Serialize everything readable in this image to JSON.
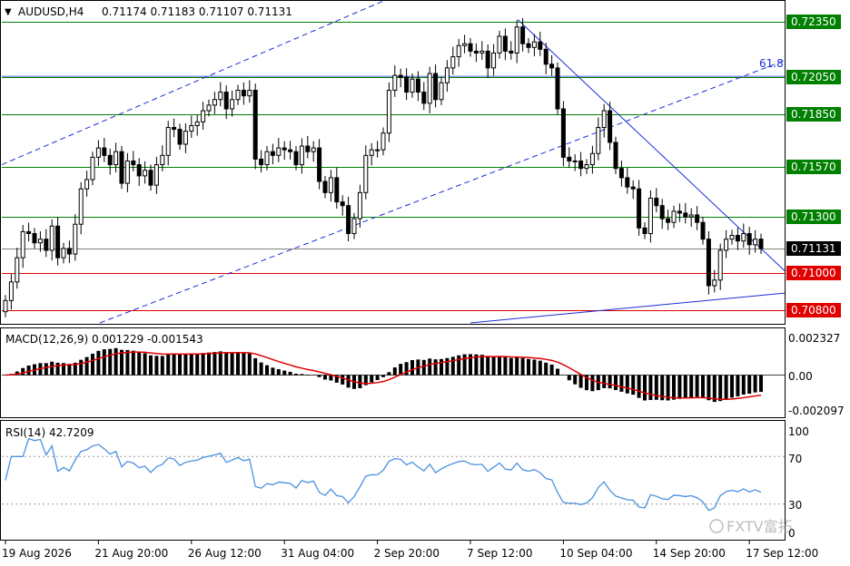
{
  "header": {
    "symbol_label": "AUDUSD,H4",
    "ohlc_label": "0.71174 0.71183 0.71107 0.71131"
  },
  "indicators": {
    "fib_label": "61.8",
    "macd_label": "MACD(12,26,9) 0.001229 -0.001543",
    "macd_scale": [
      "0.002327",
      "0.00",
      "-0.002097"
    ],
    "rsi_label": "RSI(14) 42.7209",
    "rsi_scale": [
      "100",
      "70",
      "30",
      "0"
    ]
  },
  "watermark": "FXTV富拓",
  "colors": {
    "support_line": "#e00000",
    "level_line": "#008000",
    "channel": "#1a2fd6",
    "rsi": "#4a90e2",
    "macd_signal": "#e00000",
    "current_price_badge": "#000000"
  },
  "chart_data": {
    "type": "candlestick",
    "symbol": "AUDUSD",
    "timeframe": "H4",
    "ylim": [
      0.70725,
      0.7246
    ],
    "current_price": "0.71131",
    "price_labels": [
      {
        "text": "0.72350",
        "price": 0.7235,
        "kind": "level"
      },
      {
        "text": "0.72050",
        "price": 0.7205,
        "kind": "level"
      },
      {
        "text": "0.71850",
        "price": 0.7185,
        "kind": "level"
      },
      {
        "text": "0.71570",
        "price": 0.7157,
        "kind": "level"
      },
      {
        "text": "0.71300",
        "price": 0.713,
        "kind": "level"
      },
      {
        "text": "0.71131",
        "price": 0.71131,
        "kind": "current"
      },
      {
        "text": "0.71000",
        "price": 0.71,
        "kind": "support"
      },
      {
        "text": "0.70800",
        "price": 0.708,
        "kind": "support"
      }
    ],
    "x_tick_labels": [
      "19 Aug 2026",
      "21 Aug 20:00",
      "26 Aug 12:00",
      "31 Aug 04:00",
      "2 Sep 20:00",
      "7 Sep 12:00",
      "10 Sep 04:00",
      "14 Sep 20:00",
      "17 Sep 12:00"
    ],
    "x_tick_index": [
      0,
      16,
      32,
      48,
      64,
      80,
      96,
      112,
      128
    ],
    "candles_close": [
      0.7085,
      0.7095,
      0.7108,
      0.7122,
      0.7121,
      0.7116,
      0.7118,
      0.7112,
      0.7125,
      0.7108,
      0.7113,
      0.711,
      0.7126,
      0.7145,
      0.715,
      0.7162,
      0.7167,
      0.7163,
      0.7158,
      0.7165,
      0.7148,
      0.716,
      0.7158,
      0.7152,
      0.7155,
      0.7147,
      0.7158,
      0.7163,
      0.7178,
      0.7177,
      0.7169,
      0.7176,
      0.7179,
      0.7181,
      0.7187,
      0.719,
      0.7193,
      0.7197,
      0.7188,
      0.7193,
      0.7198,
      0.7195,
      0.7198,
      0.7161,
      0.7158,
      0.7165,
      0.7163,
      0.7167,
      0.7166,
      0.7165,
      0.7158,
      0.7168,
      0.7165,
      0.7167,
      0.7149,
      0.7143,
      0.7151,
      0.7138,
      0.7136,
      0.7121,
      0.7129,
      0.7143,
      0.7163,
      0.7166,
      0.7166,
      0.7175,
      0.7198,
      0.7206,
      0.7205,
      0.7197,
      0.7204,
      0.7197,
      0.7191,
      0.7207,
      0.7193,
      0.7202,
      0.721,
      0.7216,
      0.7222,
      0.7223,
      0.7219,
      0.7218,
      0.7219,
      0.721,
      0.7218,
      0.7227,
      0.7219,
      0.7218,
      0.7232,
      0.7223,
      0.7221,
      0.7224,
      0.722,
      0.7212,
      0.721,
      0.7188,
      0.7162,
      0.716,
      0.716,
      0.7156,
      0.7158,
      0.7164,
      0.7178,
      0.7187,
      0.717,
      0.7156,
      0.7151,
      0.7146,
      0.7145,
      0.7124,
      0.7121,
      0.714,
      0.7136,
      0.7129,
      0.7127,
      0.7133,
      0.7132,
      0.713,
      0.7131,
      0.7127,
      0.7118,
      0.7093,
      0.7096,
      0.7112,
      0.7118,
      0.712,
      0.7117,
      0.7121,
      0.7115,
      0.7118,
      0.7113
    ],
    "series": []
  }
}
